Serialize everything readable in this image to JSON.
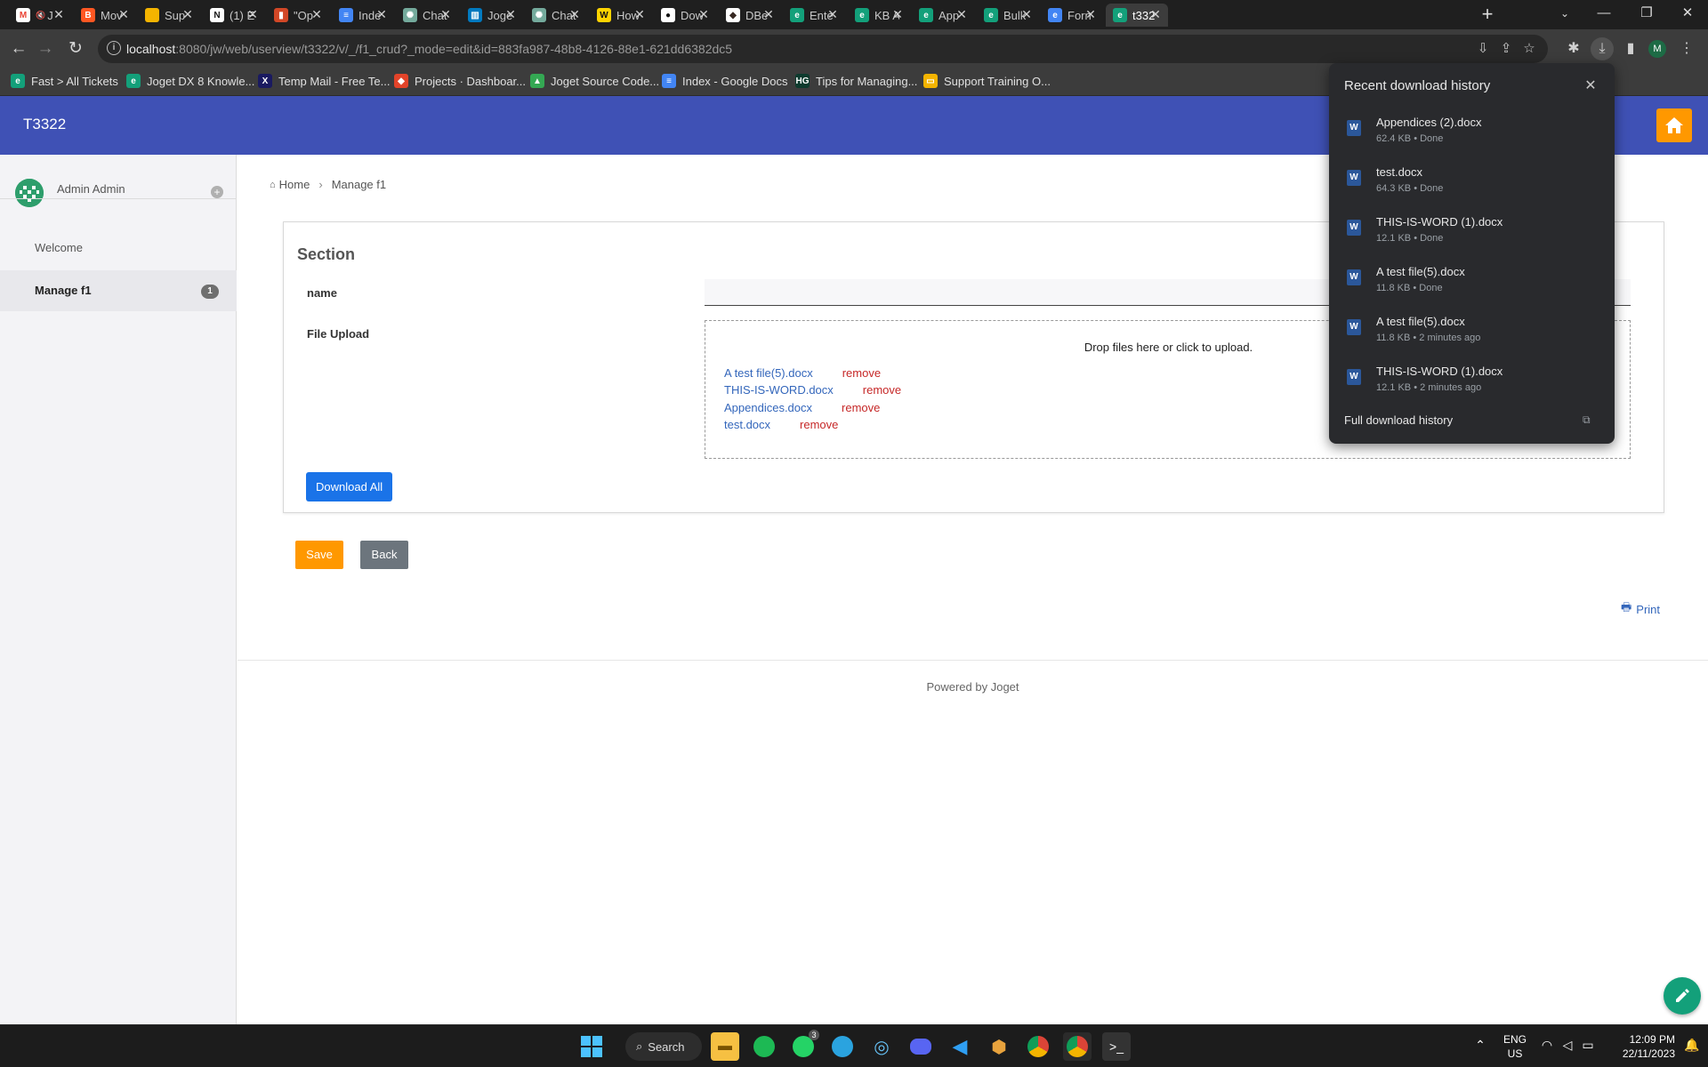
{
  "tabs": [
    {
      "label": "J",
      "icon": "gmail-icon",
      "color": "#ffffff",
      "glyph": "M",
      "glyph_color": "#ea4335",
      "muted": true
    },
    {
      "label": "Mov",
      "icon": "blogger-icon",
      "color": "#ff5722",
      "glyph": "B"
    },
    {
      "label": "Sup",
      "icon": "slides-icon",
      "color": "#f4b400",
      "glyph": ""
    },
    {
      "label": "(1) E",
      "icon": "notion-icon",
      "color": "#ffffff",
      "glyph": "N",
      "glyph_color": "#111"
    },
    {
      "label": "\"Op",
      "icon": "chart-icon",
      "color": "#d24726",
      "glyph": "▮"
    },
    {
      "label": "Inde",
      "icon": "docs-icon",
      "color": "#4285f4",
      "glyph": "≡"
    },
    {
      "label": "Chat",
      "icon": "chatgpt-icon",
      "color": "#74aa9c",
      "glyph": "✺"
    },
    {
      "label": "Joge",
      "icon": "trello-icon",
      "color": "#0079bf",
      "glyph": "▥"
    },
    {
      "label": "Chat",
      "icon": "chatgpt-icon",
      "color": "#74aa9c",
      "glyph": "✺"
    },
    {
      "label": "How",
      "icon": "w-icon",
      "color": "#ffd400",
      "glyph": "W",
      "glyph_color": "#111"
    },
    {
      "label": "Dow",
      "icon": "github-icon",
      "color": "#ffffff",
      "glyph": "●",
      "glyph_color": "#111"
    },
    {
      "label": "DBe",
      "icon": "dbeaver-icon",
      "color": "#ffffff",
      "glyph": "◆",
      "glyph_color": "#382923"
    },
    {
      "label": "Ente",
      "icon": "joget-icon",
      "color": "#13a07a",
      "glyph": "e"
    },
    {
      "label": "KB A",
      "icon": "joget-icon",
      "color": "#13a07a",
      "glyph": "e"
    },
    {
      "label": "App",
      "icon": "joget-icon",
      "color": "#13a07a",
      "glyph": "e"
    },
    {
      "label": "Bulk",
      "icon": "joget-icon",
      "color": "#13a07a",
      "glyph": "e"
    },
    {
      "label": "Forn",
      "icon": "forms-icon",
      "color": "#4285f4",
      "glyph": "e"
    },
    {
      "label": "t332",
      "icon": "joget-icon",
      "color": "#13a07a",
      "glyph": "e",
      "active": true
    }
  ],
  "address": {
    "host": "localhost",
    "path": ":8080/jw/web/userview/t3322/v/_/f1_crud?_mode=edit&id=883fa987-48b8-4126-88e1-621dd6382dc5"
  },
  "bookmarks": [
    {
      "label": "Fast > All Tickets",
      "icon": "joget-icon",
      "color": "#13a07a",
      "glyph": "e"
    },
    {
      "label": "Joget DX 8 Knowle...",
      "icon": "joget-icon",
      "color": "#13a07a",
      "glyph": "e"
    },
    {
      "label": "Temp Mail - Free Te...",
      "icon": "x-icon",
      "color": "#1a1a60",
      "glyph": "X"
    },
    {
      "label": "Projects · Dashboar...",
      "icon": "gitlab-icon",
      "color": "#e24329",
      "glyph": "◆"
    },
    {
      "label": "Joget Source Code...",
      "icon": "drive-icon",
      "color": "#34a853",
      "glyph": "▲"
    },
    {
      "label": "Index - Google Docs",
      "icon": "docs-icon",
      "color": "#4285f4",
      "glyph": "≡"
    },
    {
      "label": "Tips for Managing...",
      "icon": "hg-icon",
      "color": "#0d3b2e",
      "glyph": "HG"
    },
    {
      "label": "Support Training O...",
      "icon": "slides-icon",
      "color": "#f4b400",
      "glyph": "▭"
    }
  ],
  "app": {
    "title": "T3322"
  },
  "sidebar": {
    "user_name": "Admin Admin",
    "items": [
      {
        "label": "Welcome"
      },
      {
        "label": "Manage f1",
        "badge": "1",
        "active": true
      }
    ]
  },
  "breadcrumb": {
    "home": "Home",
    "current": "Manage f1"
  },
  "form": {
    "section_title": "Section",
    "name_label": "name",
    "name_value": "",
    "file_label": "File Upload",
    "drop_message": "Drop files here or click to upload.",
    "remove_label": "remove",
    "files": [
      "A test file(5).docx",
      "THIS-IS-WORD.docx",
      "Appendices.docx",
      "test.docx"
    ],
    "download_all": "Download All",
    "save": "Save",
    "back": "Back",
    "print": "Print"
  },
  "footer": {
    "powered_by": "Powered by Joget"
  },
  "downloads": {
    "title": "Recent download history",
    "items": [
      {
        "name": "Appendices (2).docx",
        "meta": "62.4 KB • Done"
      },
      {
        "name": "test.docx",
        "meta": "64.3 KB • Done"
      },
      {
        "name": "THIS-IS-WORD (1).docx",
        "meta": "12.1 KB • Done"
      },
      {
        "name": "A test file(5).docx",
        "meta": "11.8 KB • Done"
      },
      {
        "name": "A test file(5).docx",
        "meta": "11.8 KB • 2 minutes ago"
      },
      {
        "name": "THIS-IS-WORD (1).docx",
        "meta": "12.1 KB • 2 minutes ago"
      }
    ],
    "full_history": "Full download history"
  },
  "taskbar": {
    "search": "Search",
    "whatsapp_badge": "3",
    "language": "ENG",
    "region": "US",
    "time": "12:09 PM",
    "date": "22/11/2023"
  },
  "colors": {
    "header": "#3f51b5",
    "accent_orange": "#ff9800",
    "link_blue": "#3366bb",
    "remove_red": "#c62828"
  }
}
